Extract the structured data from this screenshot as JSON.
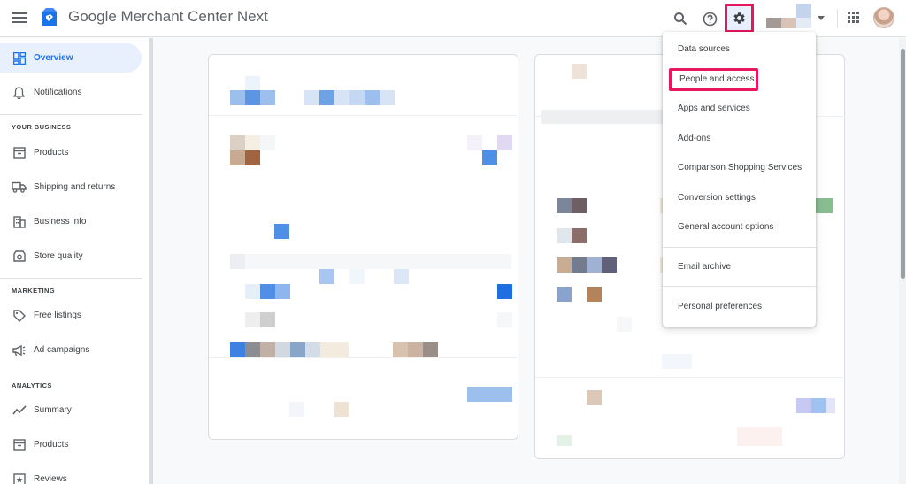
{
  "header": {
    "brand": "Google Merchant Center Next"
  },
  "sidebar": {
    "items": [
      {
        "key": "overview",
        "label": "Overview",
        "icon": "dashboard-icon"
      },
      {
        "key": "notifications",
        "label": "Notifications",
        "icon": "bell-icon"
      }
    ],
    "sections": [
      {
        "label": "YOUR BUSINESS",
        "items": [
          {
            "key": "products",
            "label": "Products",
            "icon": "box-icon"
          },
          {
            "key": "shipping",
            "label": "Shipping and returns",
            "icon": "truck-icon"
          },
          {
            "key": "business-info",
            "label": "Business info",
            "icon": "building-icon"
          },
          {
            "key": "store-quality",
            "label": "Store quality",
            "icon": "badge-icon"
          }
        ]
      },
      {
        "label": "MARKETING",
        "items": [
          {
            "key": "free-listings",
            "label": "Free listings",
            "icon": "tag-icon"
          },
          {
            "key": "ad-campaigns",
            "label": "Ad campaigns",
            "icon": "megaphone-icon"
          }
        ]
      },
      {
        "label": "ANALYTICS",
        "items": [
          {
            "key": "summary",
            "label": "Summary",
            "icon": "trend-icon"
          },
          {
            "key": "analytics-products",
            "label": "Products",
            "icon": "box-icon"
          },
          {
            "key": "reviews",
            "label": "Reviews",
            "icon": "star-icon"
          }
        ]
      }
    ]
  },
  "settings_menu": {
    "items": [
      "Data sources",
      "People and access",
      "Apps and services",
      "Add-ons",
      "Comparison Shopping Services",
      "Conversion settings",
      "General account options",
      "Email archive",
      "Personal preferences"
    ],
    "highlighted": "People and access"
  },
  "colors": {
    "accent": "#1a73e8",
    "highlight_border": "#e8175d",
    "active_nav_bg": "#e8f0fe"
  }
}
